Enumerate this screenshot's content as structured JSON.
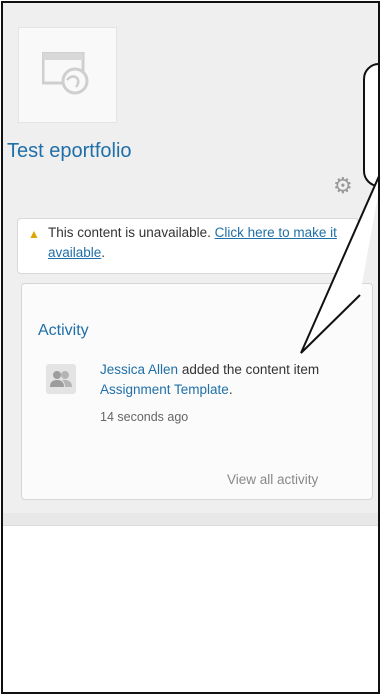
{
  "header": {
    "title": "Test eportfolio",
    "thumbnail_icon": "page-globe-icon",
    "settings_icon": "gear-icon"
  },
  "notice": {
    "icon": "warning-icon",
    "message": "This content is unavailable.",
    "link_label": "Click here to make it available",
    "trailing": "."
  },
  "activity": {
    "title": "Activity",
    "items": [
      {
        "avatar_icon": "users-icon",
        "actor": "Jessica Allen",
        "verb": "added the content item",
        "object": "Assignment Template",
        "trailing": ".",
        "time": "14 seconds ago"
      }
    ],
    "view_all_label": "View all activity"
  },
  "colors": {
    "link": "#1f6fa8",
    "warning": "#e0a400",
    "panel_bg": "#efefef"
  }
}
